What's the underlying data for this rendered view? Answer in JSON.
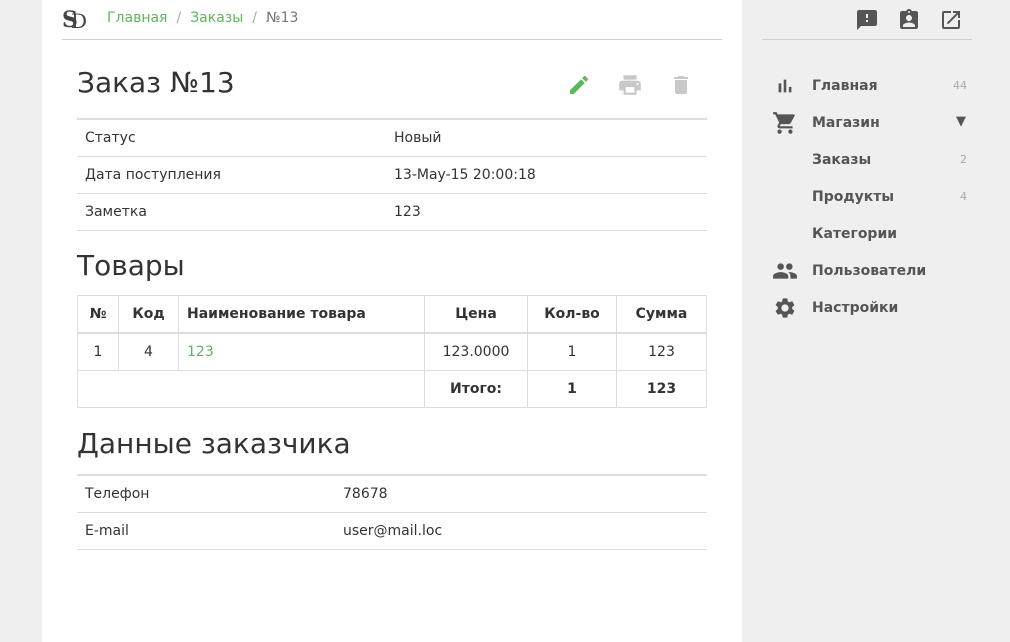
{
  "breadcrumb": {
    "home": "Главная",
    "orders": "Заказы",
    "current": "№13"
  },
  "order": {
    "title": "Заказ №13",
    "rows": [
      {
        "key": "Статус",
        "value": "Новый"
      },
      {
        "key": "Дата поступления",
        "value": "13-May-15 20:00:18"
      },
      {
        "key": "Заметка",
        "value": "123"
      }
    ],
    "actions": {
      "edit_icon": "pencil-icon",
      "print_icon": "printer-icon",
      "delete_icon": "trash-icon"
    }
  },
  "goods": {
    "title": "Товары",
    "headers": [
      "№",
      "Код",
      "Наименование товара",
      "Цена",
      "Кол-во",
      "Сумма"
    ],
    "rows": [
      {
        "n": "1",
        "code": "4",
        "name": "123",
        "price": "123.0000",
        "qty": "1",
        "sum": "123"
      }
    ],
    "total": {
      "label": "Итого:",
      "qty": "1",
      "sum": "123"
    }
  },
  "customer": {
    "title": "Данные заказчика",
    "rows": [
      {
        "key": "Телефон",
        "value": "78678"
      },
      {
        "key": "E-mail",
        "value": "user@mail.loc"
      }
    ]
  },
  "sidebar": {
    "top_icons": [
      "feedback-icon",
      "contact-card-icon",
      "open-external-icon"
    ],
    "items": [
      {
        "label": "Главная",
        "count": "44",
        "icon": "bar-chart-icon"
      },
      {
        "label": "Магазин",
        "arrow": "▼",
        "icon": "cart-icon"
      },
      {
        "label": "Заказы",
        "count": "2"
      },
      {
        "label": "Продукты",
        "count": "4"
      },
      {
        "label": "Категории"
      },
      {
        "label": "Пользователи",
        "icon": "users-icon"
      },
      {
        "label": "Настройки",
        "icon": "gear-icon"
      }
    ]
  },
  "colors": {
    "accent": "#5cb85c",
    "icon_muted": "#c8c8c8",
    "sidebar_icon": "#555555"
  }
}
